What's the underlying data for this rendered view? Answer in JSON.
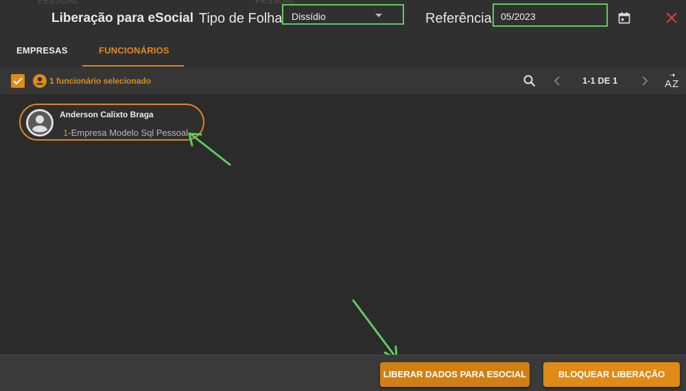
{
  "header": {
    "ghost_text": "PESSOAL",
    "title": "Liberação para eSocial",
    "tipo_folha_label": "Tipo de Folha",
    "tipo_folha_value": "Dissídio",
    "referencia_label": "Referência",
    "referencia_value": "05/2023"
  },
  "tabs": [
    {
      "label": "EMPRESAS",
      "active": false
    },
    {
      "label": "FUNCIONÁRIOS",
      "active": true
    }
  ],
  "toolbar": {
    "selected_text": "1 funcionário selecionado",
    "page_info": "1-1 DE 1"
  },
  "employee": {
    "name": "Anderson Calixto Braga",
    "company_code": "1",
    "company_name": "-Empresa Modelo Sql Pessoal"
  },
  "footer": {
    "liberar_label": "LIBERAR DADOS PARA ESOCIAL",
    "bloquear_label": "BLOQUEAR LIBERAÇÃO"
  },
  "colors": {
    "accent": "#e08a18",
    "highlight": "#5ecf5e",
    "close": "#e04040"
  }
}
